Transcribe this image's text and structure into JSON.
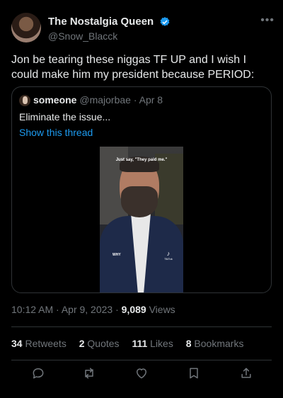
{
  "author": {
    "name": "The Nostalgia Queen",
    "handle": "@Snow_Blacck"
  },
  "tweet": {
    "text": "Jon be tearing these niggas TF UP and I wish I could make him my president because PERIOD:"
  },
  "quote": {
    "name": "someone",
    "handle": "@majorbae",
    "dot": " · ",
    "date": "Apr 8",
    "text": "Eliminate the issue...",
    "link": "Show this thread",
    "video": {
      "caption": "Just say, \"They paid me.\"",
      "subtitle": "WHY",
      "watermark": "TikTok",
      "watermark_handle": "@"
    }
  },
  "meta": {
    "time_date": "10:12 AM · Apr 9, 2023 · ",
    "views_count": "9,089",
    "views_label": " Views"
  },
  "stats": [
    {
      "num": "34",
      "label": " Retweets"
    },
    {
      "num": "2",
      "label": " Quotes"
    },
    {
      "num": "111",
      "label": " Likes"
    },
    {
      "num": "8",
      "label": " Bookmarks"
    }
  ],
  "colors": {
    "background": "#000000",
    "text": "#e7e9ea",
    "muted": "#71767b",
    "link": "#1d9bf0",
    "border": "#2f3336"
  },
  "icons": [
    "verified-badge-icon",
    "more-icon",
    "reply-icon",
    "retweet-icon",
    "like-icon",
    "bookmark-icon",
    "share-icon",
    "tiktok-icon"
  ]
}
